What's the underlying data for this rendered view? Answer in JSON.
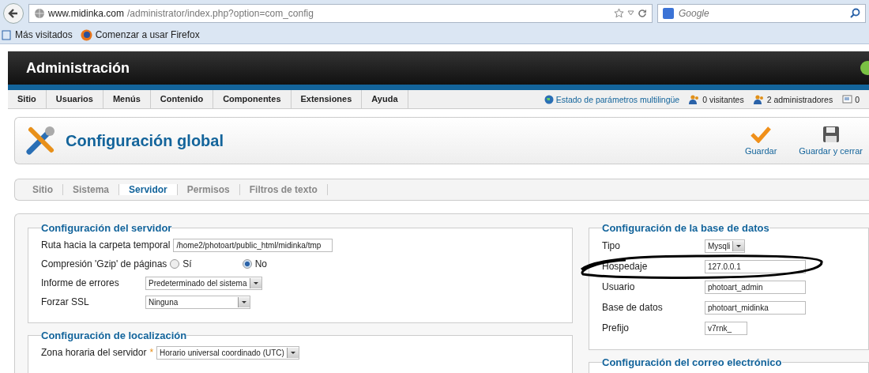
{
  "browser": {
    "url_host": "www.midinka.com",
    "url_path": "/administrator/index.php?option=com_config",
    "search_placeholder": "Google"
  },
  "bookmarks": [
    {
      "label": "Más visitados",
      "kind": "page"
    },
    {
      "label": "Comenzar a usar Firefox",
      "kind": "firefox"
    }
  ],
  "header": {
    "title": "Administración"
  },
  "menu": [
    "Sitio",
    "Usuarios",
    "Menús",
    "Contenido",
    "Componentes",
    "Extensiones",
    "Ayuda"
  ],
  "status": [
    {
      "label": "Estado de parámetros multilingüe",
      "kind": "globe"
    },
    {
      "label": "0 visitantes",
      "kind": "users"
    },
    {
      "label": "2 administradores",
      "kind": "users"
    },
    {
      "label": "0",
      "kind": "mail"
    }
  ],
  "page_title": "Configuración global",
  "toolbar": [
    {
      "label": "Guardar",
      "kind": "check"
    },
    {
      "label": "Guardar y cerrar",
      "kind": "save"
    }
  ],
  "tabs": [
    {
      "label": "Sitio",
      "selected": false
    },
    {
      "label": "Sistema",
      "selected": false
    },
    {
      "label": "Servidor",
      "selected": true
    },
    {
      "label": "Permisos",
      "selected": false
    },
    {
      "label": "Filtros de texto",
      "selected": false
    }
  ],
  "server": {
    "legend": "Configuración del servidor",
    "fields": [
      {
        "kind": "text",
        "label": "Ruta hacia la carpeta temporal",
        "value": "/home2/photoart/public_html/midinka/tmp"
      },
      {
        "kind": "radio",
        "label": "Compresión 'Gzip' de páginas",
        "options": [
          {
            "label": "Sí",
            "selected": false
          },
          {
            "label": "No",
            "selected": true
          }
        ]
      },
      {
        "kind": "select",
        "label": "Informe de errores",
        "value": "Predeterminado del sistema"
      },
      {
        "kind": "select",
        "label": "Forzar SSL",
        "value": "Ninguna"
      }
    ]
  },
  "locale": {
    "legend": "Configuración de localización",
    "label": "Zona horaria del servidor",
    "required": "*",
    "value": "Horario universal coordinado (UTC)"
  },
  "database": {
    "legend": "Configuración de la base de datos",
    "fields": [
      {
        "kind": "select",
        "label": "Tipo",
        "value": "Mysqli"
      },
      {
        "kind": "text",
        "label": "Hospedaje",
        "value": "127.0.0.1"
      },
      {
        "kind": "text",
        "label": "Usuario",
        "value": "photoart_admin"
      },
      {
        "kind": "text",
        "label": "Base de datos",
        "value": "photoart_midinka"
      },
      {
        "kind": "short",
        "label": "Prefijo",
        "value": "v7rnk_"
      }
    ]
  },
  "mail": {
    "legend": "Configuración del correo electrónico"
  }
}
